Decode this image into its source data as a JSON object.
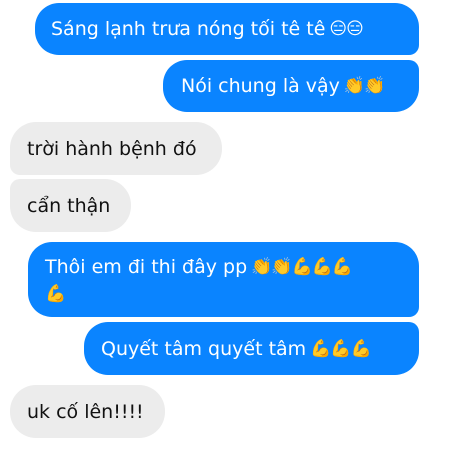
{
  "messages": [
    {
      "side": "out",
      "text": "Sáng lạnh trưa nóng tối tê tê",
      "emoji": "😑😑"
    },
    {
      "side": "out",
      "text": "Nói chung là vậy",
      "emoji": "👏👏"
    },
    {
      "side": "in",
      "text": "trời hành bệnh đó",
      "emoji": ""
    },
    {
      "side": "in",
      "text": "cẩn thận",
      "emoji": ""
    },
    {
      "side": "out",
      "text": "Thôi em đi thi đây pp",
      "emoji": "👏👏💪💪💪",
      "emoji_line2": "💪"
    },
    {
      "side": "out",
      "text": "Quyết tâm quyết tâm",
      "emoji": "💪💪💪"
    },
    {
      "side": "in",
      "text": "uk cố lên!!!!",
      "emoji": ""
    }
  ]
}
